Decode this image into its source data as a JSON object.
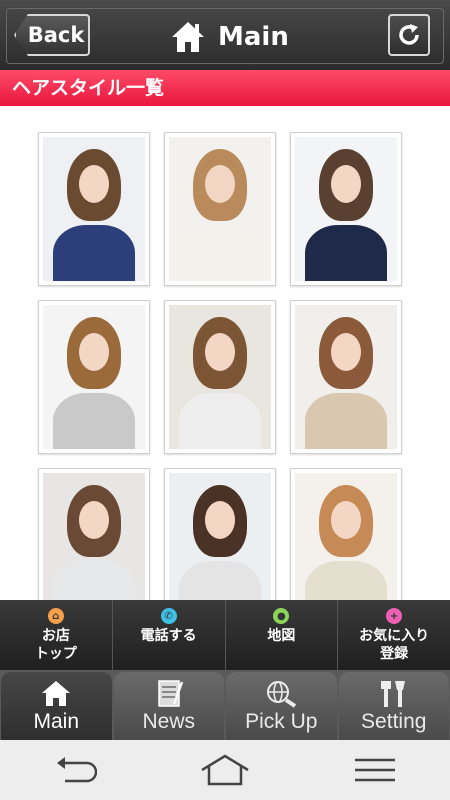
{
  "header": {
    "back_label": "Back",
    "title": "Main",
    "home_icon": "home-icon",
    "refresh_icon": "refresh-icon"
  },
  "section": {
    "title": "ヘアスタイル一覧"
  },
  "gallery": {
    "items": [
      {
        "hair": "#6b4a32",
        "top": "#2c3f7a",
        "bg": "#eef0f3"
      },
      {
        "hair": "#b88a5c",
        "top": "#f4f1ec",
        "bg": "#f3f1ee"
      },
      {
        "hair": "#5a4030",
        "top": "#1f2a4a",
        "bg": "#f2f4f6"
      },
      {
        "hair": "#9a6a3a",
        "top": "#c9c9c9",
        "bg": "#f4f4f4"
      },
      {
        "hair": "#7b5534",
        "top": "#eeeeee",
        "bg": "#e9e5df"
      },
      {
        "hair": "#8a5a3a",
        "top": "#d9c7b0",
        "bg": "#f1efec"
      },
      {
        "hair": "#6a4a34",
        "top": "#e6e8ea",
        "bg": "#e8e6e4"
      },
      {
        "hair": "#4a3326",
        "top": "#e4e4e4",
        "bg": "#eceff2"
      },
      {
        "hair": "#c68a56",
        "top": "#e4dfcf",
        "bg": "#f4f1ec"
      }
    ]
  },
  "actions": [
    {
      "label": "お店\nトップ",
      "icon": "home-icon",
      "color": "#f5a04a"
    },
    {
      "label": "電話する",
      "icon": "phone-icon",
      "color": "#3fc0e6"
    },
    {
      "label": "地図",
      "icon": "map-pin-icon",
      "color": "#8bd45a"
    },
    {
      "label": "お気に入り\n登録",
      "icon": "plus-icon",
      "color": "#ee5fb6"
    }
  ],
  "tabs": [
    {
      "label": "Main",
      "icon": "home-icon",
      "active": true
    },
    {
      "label": "News",
      "icon": "news-icon",
      "active": false
    },
    {
      "label": "Pick Up",
      "icon": "globe-search-icon",
      "active": false
    },
    {
      "label": "Setting",
      "icon": "tools-icon",
      "active": false
    }
  ],
  "colors": {
    "accent": "#e8173e",
    "header": "#333333"
  }
}
